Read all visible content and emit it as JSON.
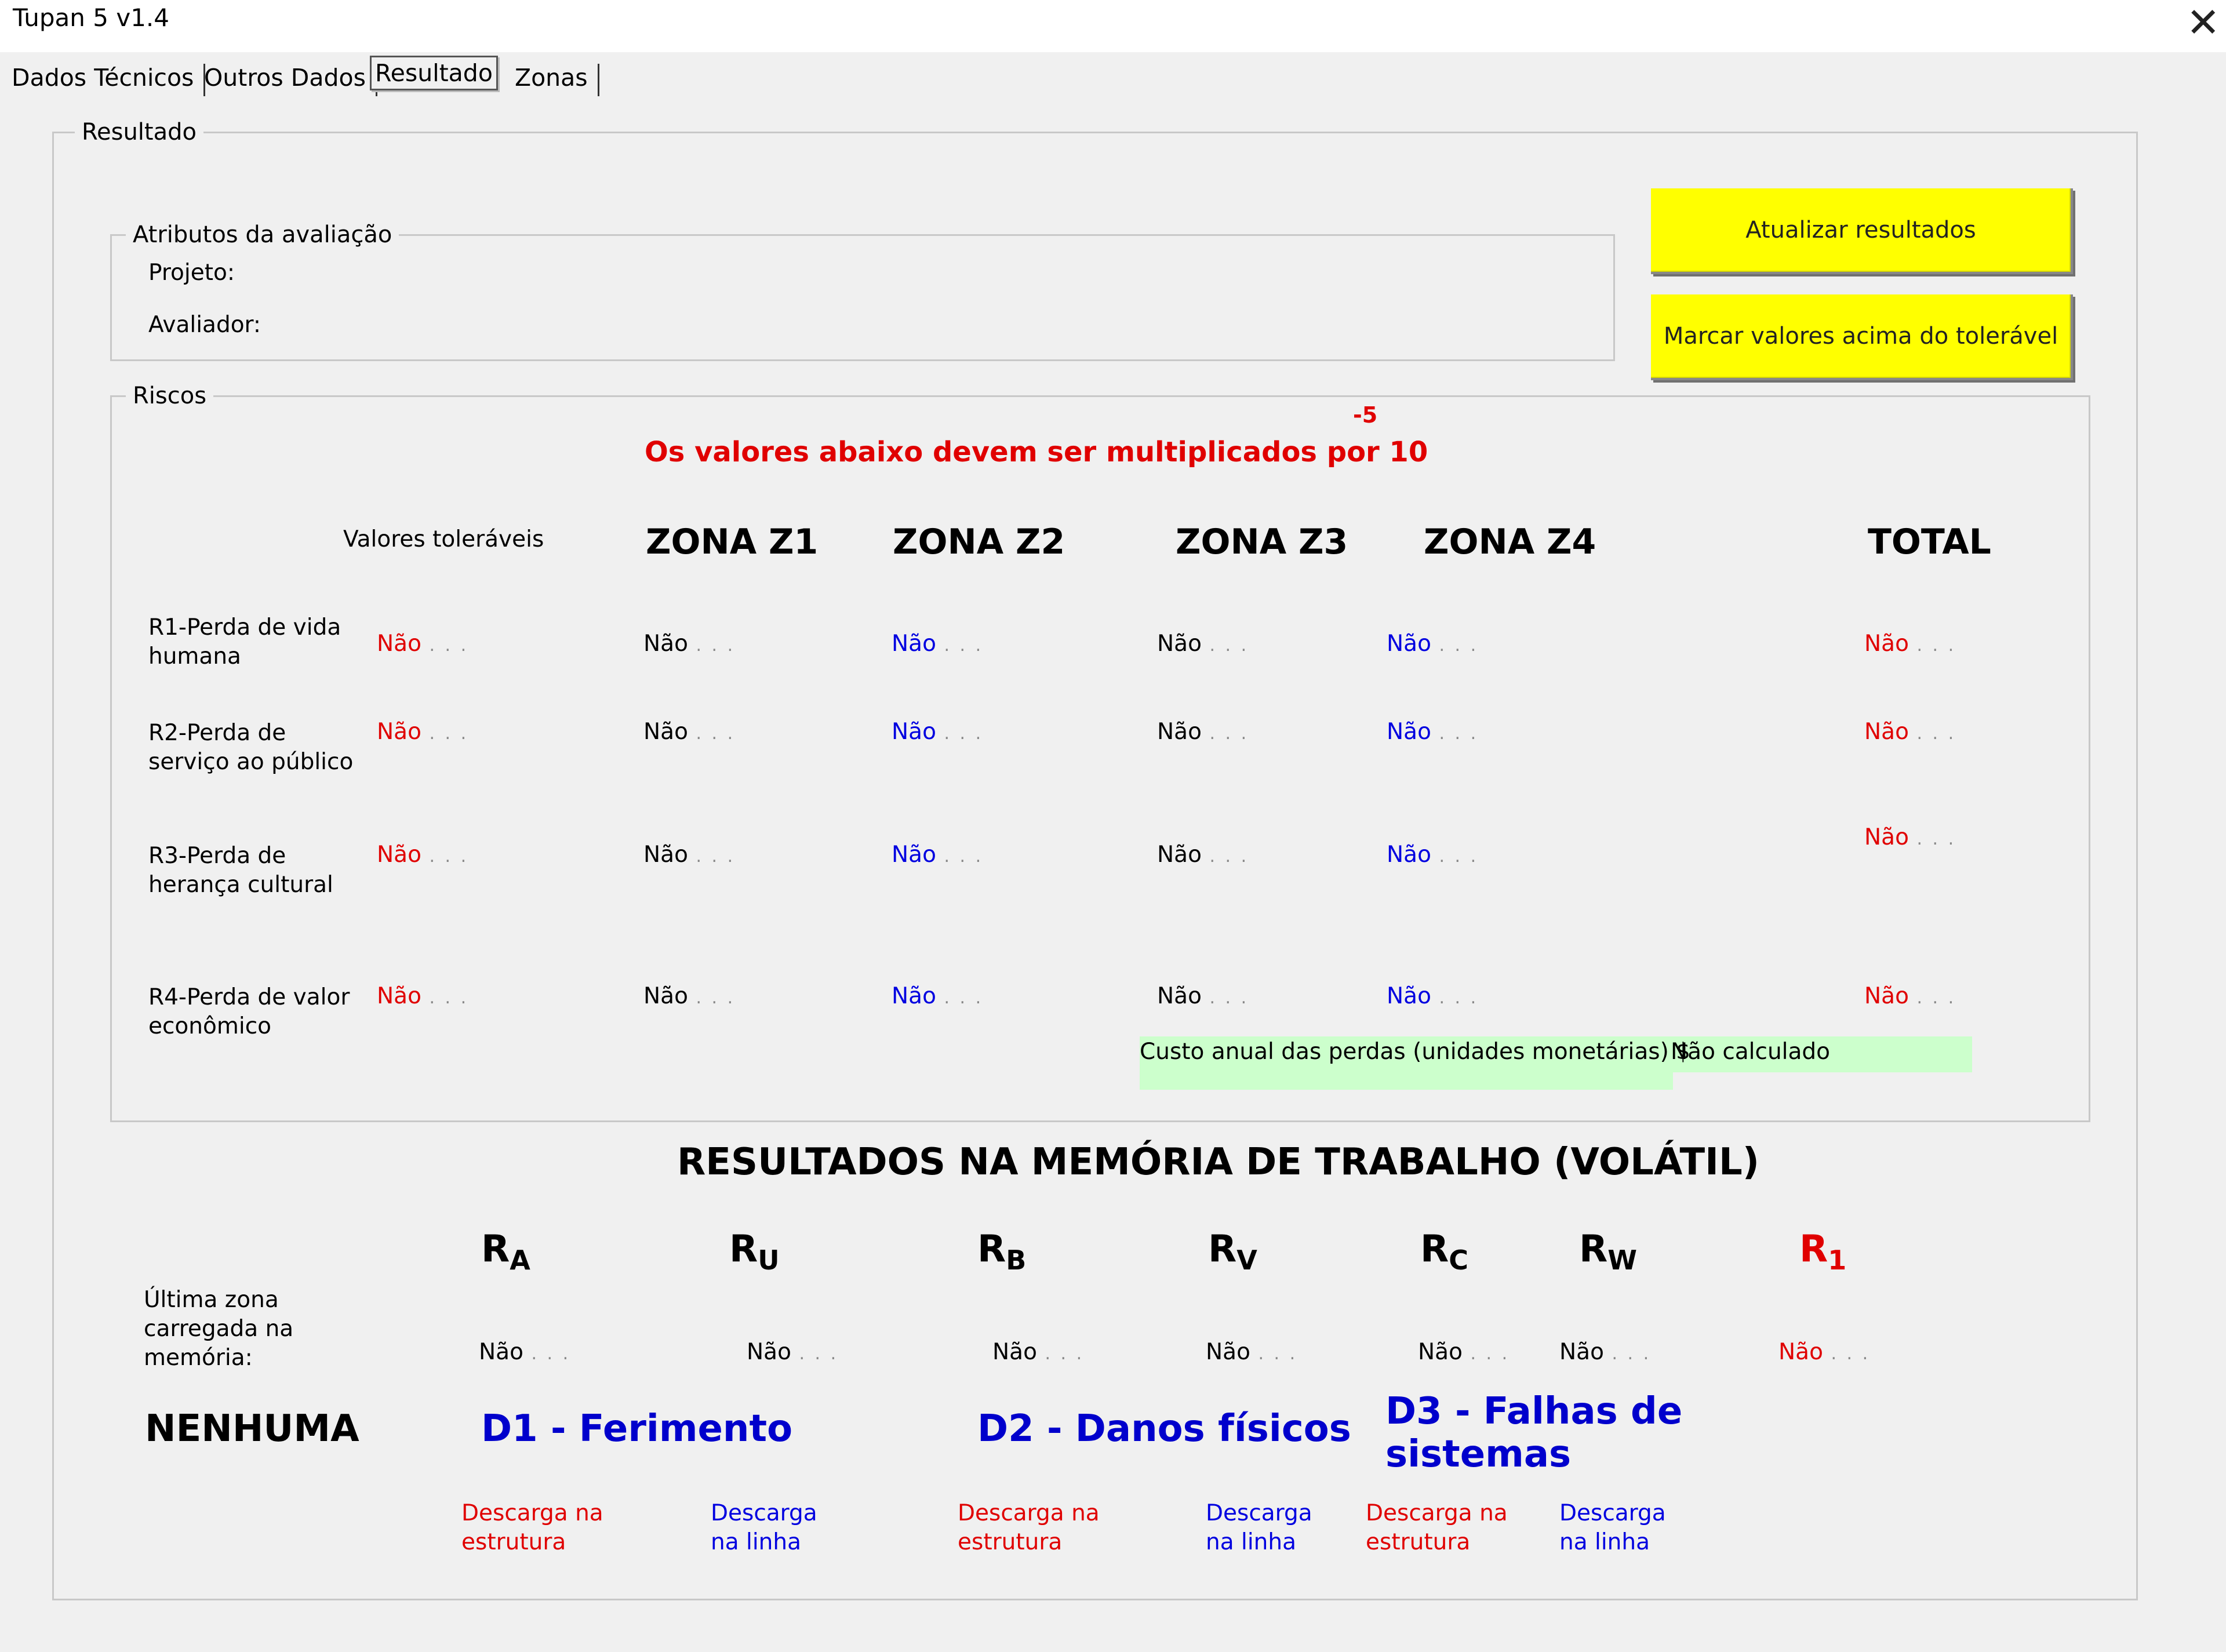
{
  "window": {
    "title": "Tupan 5 v1.4",
    "close_glyph": "✕"
  },
  "tabs": [
    {
      "label": "Dados Técnicos"
    },
    {
      "label": "Outros Dados"
    },
    {
      "label": "Resultado"
    },
    {
      "label": "Zonas"
    }
  ],
  "resultado": {
    "legend": "Resultado",
    "buttons": {
      "update": "Atualizar resultados",
      "mark": "Marcar valores acima do tolerável"
    },
    "atributos": {
      "legend": "Atributos da avaliação",
      "projeto_label": "Projeto:",
      "avaliador_label": "Avaliador:"
    },
    "riscos": {
      "legend": "Riscos",
      "multiplier_note": "Os valores abaixo devem ser multiplicados por 10",
      "exponent": "-5",
      "tolerable_header": "Valores toleráveis",
      "zone_headers": [
        "ZONA Z1",
        "ZONA Z2",
        "ZONA Z3",
        "ZONA Z4",
        "TOTAL"
      ],
      "rows": [
        {
          "label": "R1-Perda de vida humana",
          "tolerable": "Não",
          "z1": "Não",
          "z2": "Não",
          "z3": "Não",
          "z4": "Não",
          "total": "Não"
        },
        {
          "label": "R2-Perda de serviço ao público",
          "tolerable": "Não",
          "z1": "Não",
          "z2": "Não",
          "z3": "Não",
          "z4": "Não",
          "total": "Não"
        },
        {
          "label": "R3-Perda de herança cultural",
          "tolerable": "Não",
          "z1": "Não",
          "z2": "Não",
          "z3": "Não",
          "z4": "Não",
          "total": "Não"
        },
        {
          "label": "R4-Perda de valor econômico",
          "tolerable": "Não",
          "z1": "Não",
          "z2": "Não",
          "z3": "Não",
          "z4": "Não",
          "total": "Não"
        }
      ],
      "annual_cost_label": "Custo anual das perdas (unidades monetárias) $",
      "annual_cost_value": "Não calculado"
    },
    "memoria": {
      "title": "RESULTADOS NA MEMÓRIA DE TRABALHO (VOLÁTIL)",
      "last_zone_label": "Última zona carregada na memória:",
      "last_zone_value": "NENHUMA",
      "components": [
        {
          "main": "R",
          "sub": "A",
          "value": "Não"
        },
        {
          "main": "R",
          "sub": "U",
          "value": "Não"
        },
        {
          "main": "R",
          "sub": "B",
          "value": "Não"
        },
        {
          "main": "R",
          "sub": "V",
          "value": "Não"
        },
        {
          "main": "R",
          "sub": "C",
          "value": "Não"
        },
        {
          "main": "R",
          "sub": "W",
          "value": "Não"
        },
        {
          "main": "R",
          "sub": "1",
          "value": "Não"
        }
      ],
      "damages": [
        "D1 - Ferimento",
        "D2 - Danos físicos",
        "D3 - Falhas de sistemas"
      ],
      "discharges": [
        "Descarga na estrutura",
        "Descarga na linha",
        "Descarga na estrutura",
        "Descarga na linha",
        "Descarga na estrutura",
        "Descarga na linha"
      ]
    }
  },
  "colors": {
    "button_yellow": "#ffff00",
    "alert_red": "#e00000",
    "zone_blue": "#0000e0",
    "cost_green": "#ccffcc"
  }
}
